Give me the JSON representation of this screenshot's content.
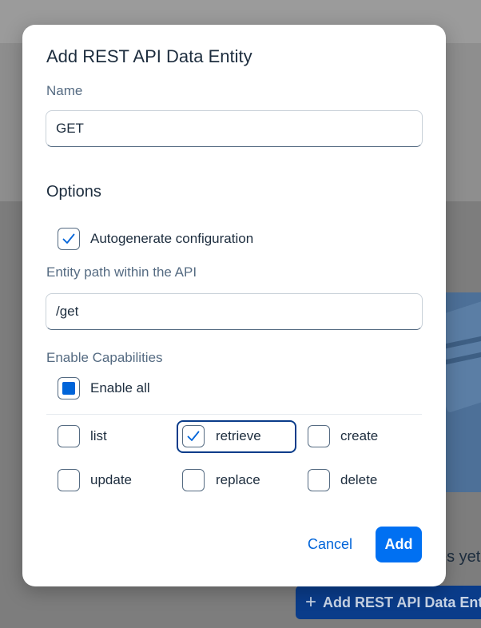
{
  "background": {
    "empty_state_text": "es yet",
    "add_button_icon": "plus-icon",
    "add_button_label": "Add REST API Data Enti"
  },
  "dialog": {
    "title": "Add REST API Data Entity",
    "name_label": "Name",
    "name_value": "GET",
    "options_heading": "Options",
    "autogenerate": {
      "label": "Autogenerate configuration",
      "checked": true
    },
    "path_label": "Entity path within the API",
    "path_value": "/get",
    "capabilities_label": "Enable Capabilities",
    "enable_all": {
      "label": "Enable all",
      "state": "indeterminate"
    },
    "capabilities": [
      {
        "label": "list",
        "checked": false
      },
      {
        "label": "retrieve",
        "checked": true
      },
      {
        "label": "create",
        "checked": false
      },
      {
        "label": "update",
        "checked": false
      },
      {
        "label": "replace",
        "checked": false
      },
      {
        "label": "delete",
        "checked": false
      }
    ],
    "cancel_label": "Cancel",
    "add_label": "Add"
  },
  "colors": {
    "accent": "#0070f2",
    "focus_border": "#0a3c8a",
    "text": "#1d2d3e",
    "label": "#556b82"
  }
}
